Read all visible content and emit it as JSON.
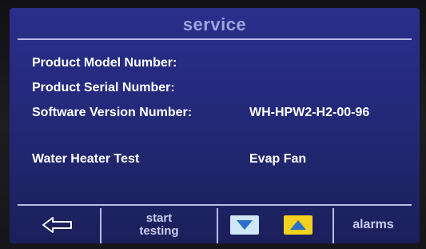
{
  "header": {
    "title": "service"
  },
  "info": {
    "rows": [
      {
        "label": "Product Model Number:",
        "value": ""
      },
      {
        "label": "Product Serial Number:",
        "value": ""
      },
      {
        "label": "Software Version Number:",
        "value": "WH-HPW2-H2-00-96"
      }
    ]
  },
  "test": {
    "label": "Water Heater Test",
    "value": "Evap Fan"
  },
  "footer": {
    "back_icon": "left-arrow-icon",
    "start_line1": "start",
    "start_line2": "testing",
    "down_icon": "down-triangle-icon",
    "up_icon": "up-triangle-icon",
    "alarms_label": "alarms"
  },
  "colors": {
    "screen_blue": "#252a7e",
    "title_text": "#9fa3e0",
    "down_button": "#cfe6f5",
    "up_button": "#f2d21e",
    "triangle": "#2a6fc9"
  }
}
